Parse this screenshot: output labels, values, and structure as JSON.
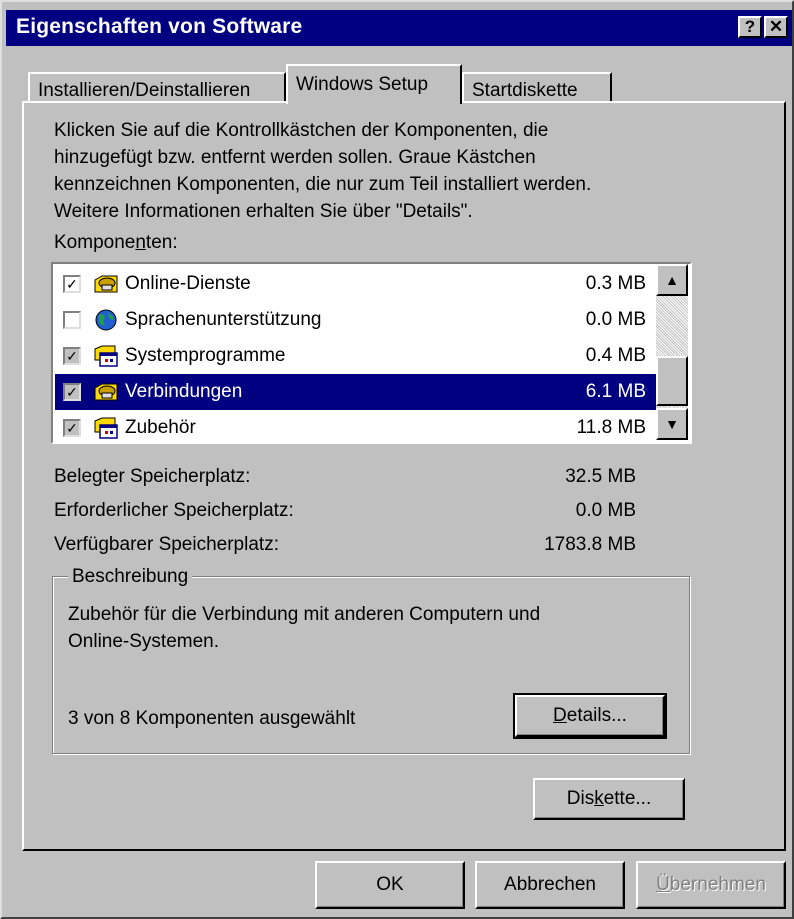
{
  "window": {
    "title": "Eigenschaften von Software",
    "help_label": "?",
    "close_label": "✕"
  },
  "tabs": [
    {
      "label": "Installieren/Deinstallieren",
      "active": false
    },
    {
      "label": "Windows Setup",
      "active": true
    },
    {
      "label": "Startdiskette",
      "active": false
    }
  ],
  "instructions": {
    "line1": "Klicken Sie auf die Kontrollkästchen der Komponenten, die",
    "line2": "hinzugefügt bzw. entfernt werden sollen. Graue Kästchen",
    "line3": "kennzeichnen Komponenten, die nur zum Teil installiert werden.",
    "line4": "Weitere Informationen erhalten Sie über \"Details\"."
  },
  "components_label": {
    "pre": "Kompone",
    "accel": "n",
    "post": "ten:"
  },
  "components": [
    {
      "name": "Online-Dienste",
      "size": "0.3 MB",
      "checked": true,
      "gray": false,
      "icon": "phone-folder-icon",
      "selected": false
    },
    {
      "name": "Sprachenunterstützung",
      "size": "0.0 MB",
      "checked": false,
      "gray": false,
      "icon": "globe-icon",
      "selected": false
    },
    {
      "name": "Systemprogramme",
      "size": "0.4 MB",
      "checked": true,
      "gray": true,
      "icon": "program-window-icon",
      "selected": false
    },
    {
      "name": "Verbindungen",
      "size": "6.1 MB",
      "checked": true,
      "gray": true,
      "icon": "phone-folder-icon",
      "selected": true
    },
    {
      "name": "Zubehör",
      "size": "11.8 MB",
      "checked": true,
      "gray": true,
      "icon": "program-window-icon",
      "selected": false
    }
  ],
  "space": {
    "used_label": "Belegter Speicherplatz:",
    "used_value": "32.5 MB",
    "required_label": "Erforderlicher Speicherplatz:",
    "required_value": "0.0 MB",
    "available_label": "Verfügbarer Speicherplatz:",
    "available_value": "1783.8 MB"
  },
  "description": {
    "legend": "Beschreibung",
    "line1": "Zubehör für die Verbindung mit anderen Computern und",
    "line2": "Online-Systemen.",
    "selection_count": "3 von 8 Komponenten ausgewählt"
  },
  "buttons": {
    "details": {
      "accel": "D",
      "rest": "etails..."
    },
    "diskette": {
      "pre": "Dis",
      "accel": "k",
      "post": "ette..."
    },
    "ok": "OK",
    "cancel": "Abbrechen",
    "apply": {
      "accel": "Ü",
      "rest": "bernehmen"
    }
  },
  "colors": {
    "face": "#c0c0c0",
    "titlebar": "#000080",
    "selection": "#000080"
  }
}
